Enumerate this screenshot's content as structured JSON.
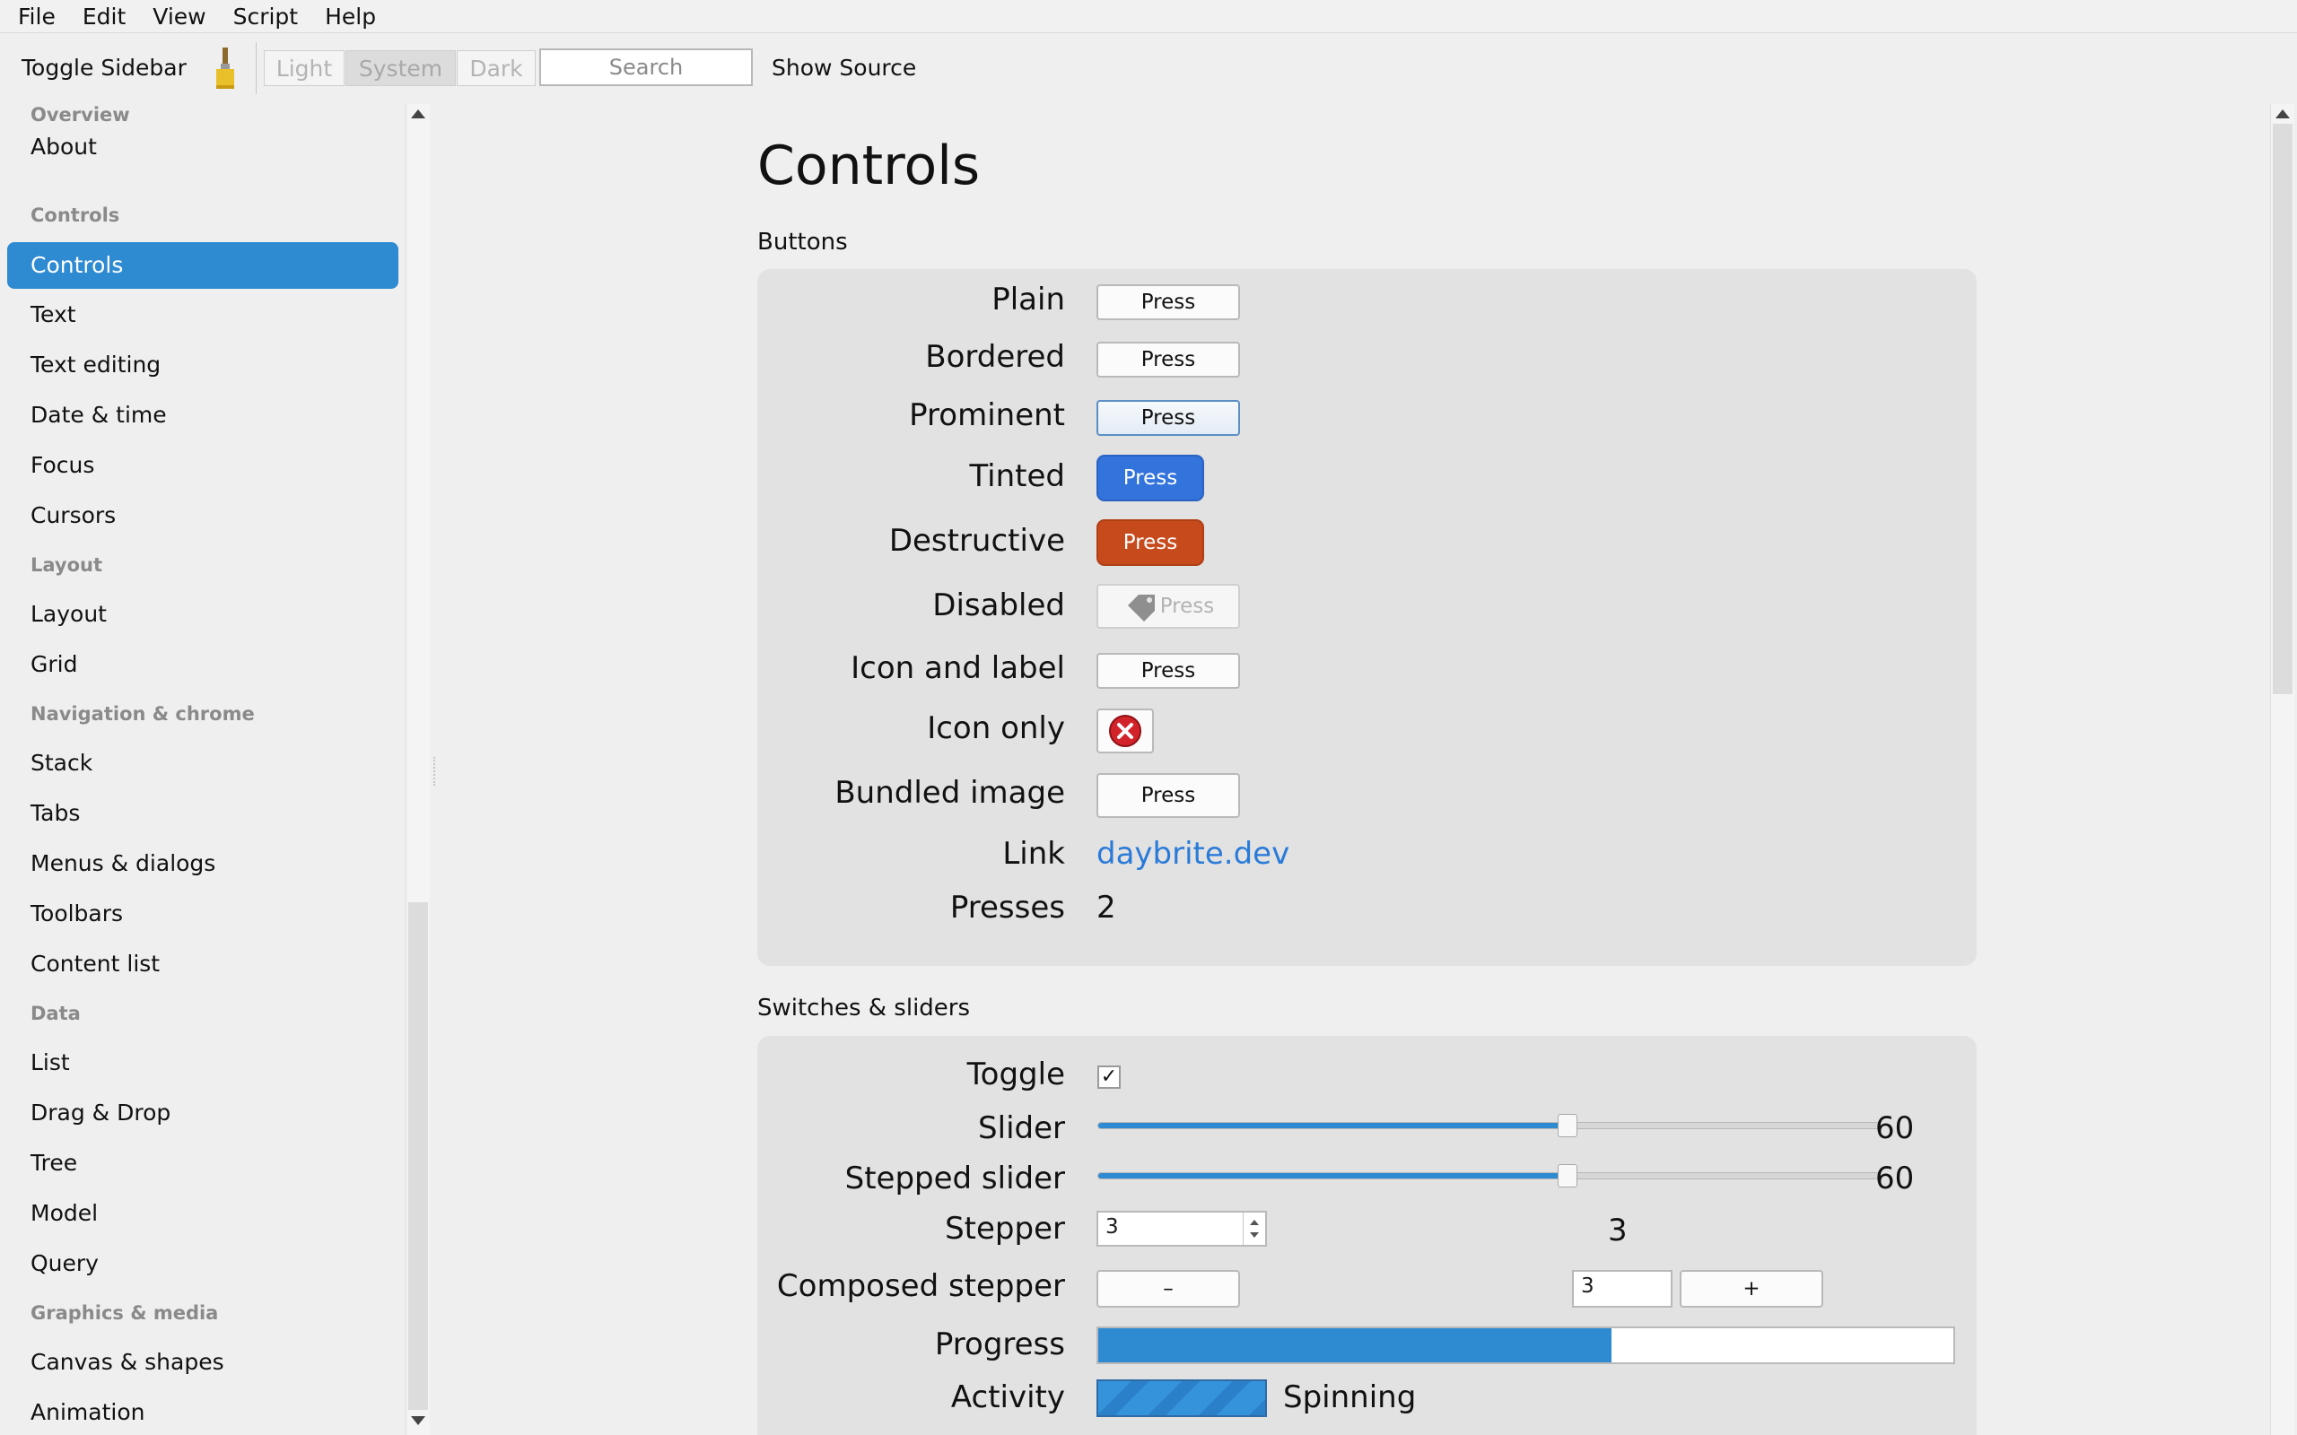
{
  "menu": [
    "File",
    "Edit",
    "View",
    "Script",
    "Help"
  ],
  "toolbar": {
    "toggle_sidebar": "Toggle Sidebar",
    "appearance": [
      "Light",
      "System",
      "Dark"
    ],
    "appearance_selected": "System",
    "search_placeholder": "Search",
    "show_source": "Show Source"
  },
  "sidebar": {
    "groups": [
      {
        "header": "Overview",
        "items": [
          "About"
        ]
      },
      {
        "header": "Controls",
        "items": [
          "Controls",
          "Text",
          "Text editing",
          "Date & time",
          "Focus",
          "Cursors"
        ]
      },
      {
        "header": "Layout",
        "items": [
          "Layout",
          "Grid"
        ]
      },
      {
        "header": "Navigation & chrome",
        "items": [
          "Stack",
          "Tabs",
          "Menus & dialogs",
          "Toolbars",
          "Content list"
        ]
      },
      {
        "header": "Data",
        "items": [
          "List",
          "Drag & Drop",
          "Tree",
          "Model",
          "Query"
        ]
      },
      {
        "header": "Graphics & media",
        "items": [
          "Canvas & shapes",
          "Animation"
        ]
      }
    ],
    "selected": "Controls"
  },
  "main": {
    "title": "Controls",
    "buttons_section": {
      "title": "Buttons",
      "rows": {
        "plain": {
          "label": "Plain",
          "button": "Press"
        },
        "bordered": {
          "label": "Bordered",
          "button": "Press"
        },
        "prominent": {
          "label": "Prominent",
          "button": "Press"
        },
        "tinted": {
          "label": "Tinted",
          "button": "Press"
        },
        "destructive": {
          "label": "Destructive",
          "button": "Press"
        },
        "disabled": {
          "label": "Disabled",
          "button": "Press"
        },
        "icon_and_label": {
          "label": "Icon and label",
          "button": "Press"
        },
        "icon_only": {
          "label": "Icon only",
          "icon": "close-circle-icon"
        },
        "bundled_image": {
          "label": "Bundled image",
          "button": "Press"
        },
        "link": {
          "label": "Link",
          "text": "daybrite.dev"
        },
        "presses": {
          "label": "Presses",
          "value": "2"
        }
      }
    },
    "switches_section": {
      "title": "Switches & sliders",
      "rows": {
        "toggle": {
          "label": "Toggle",
          "checked": true,
          "mark": "✓"
        },
        "slider": {
          "label": "Slider",
          "value": "60",
          "fraction": 0.6
        },
        "stepped_slider": {
          "label": "Stepped slider",
          "value": "60",
          "fraction": 0.6
        },
        "stepper": {
          "label": "Stepper",
          "field": "3",
          "value": "3"
        },
        "composed_stepper": {
          "label": "Composed stepper",
          "minus": "–",
          "field": "3",
          "plus": "+"
        },
        "progress": {
          "label": "Progress",
          "fraction": 0.6
        },
        "activity": {
          "label": "Activity",
          "status": "Spinning"
        }
      }
    }
  },
  "colors": {
    "accent": "#2e8ad1",
    "tinted": "#3273dc",
    "destructive": "#c74a1c",
    "link": "#2a7bd8"
  }
}
